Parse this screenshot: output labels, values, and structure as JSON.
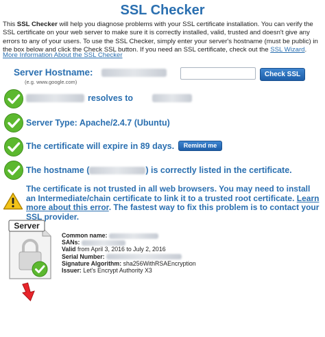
{
  "title": "SSL Checker",
  "intro": {
    "p1": "This ",
    "bold": "SSL Checker",
    "p2": " will help you diagnose problems with your SSL certificate installation. You can verify the SSL certificate on your web server to make sure it is correctly installed, valid, trusted and doesn't give any errors to any of your users. To use the SSL Checker, simply enter your server's hostname (must be public) in the box below and click the Check SSL button. If you need an SSL certificate, check out the ",
    "link": "SSL Wizard",
    "p3": "."
  },
  "more_link": "More Information About the SSL Checker",
  "host": {
    "label": "Server Hostname:",
    "example": "(e.g. www.google.com)",
    "check_button": "Check SSL"
  },
  "results": {
    "resolves": "resolves to",
    "server_type": "Server Type: Apache/2.4.7 (Ubuntu)",
    "expire": "The certificate will expire in 89 days.",
    "remind_button": "Remind me",
    "hostname_pre": "The hostname (",
    "hostname_post": ") is correctly listed in the certificate.",
    "warning_text": "The certificate is not trusted in all web browsers. You may need to install an Intermediate/chain certificate to link it to a trusted root certificate. ",
    "warning_link": "Learn more about this error",
    "warning_text2": ". The fastest way to fix this problem is to contact your SSL provider."
  },
  "cert": {
    "server_label": "Server",
    "common_name_label": "Common name:",
    "sans_label": "SANs:",
    "valid_label": "Valid",
    "valid_value": " from April 3, 2016 to July 2, 2016",
    "serial_label": "Serial Number:",
    "sig_label": "Signature Algorithm:",
    "sig_value": " sha256WithRSAEncryption",
    "issuer_label": "Issuer:",
    "issuer_value": " Let's Encrypt Authority X3"
  },
  "colors": {
    "accent": "#2a6fb0",
    "check": "#5cb82f",
    "warning": "#f2c318"
  }
}
